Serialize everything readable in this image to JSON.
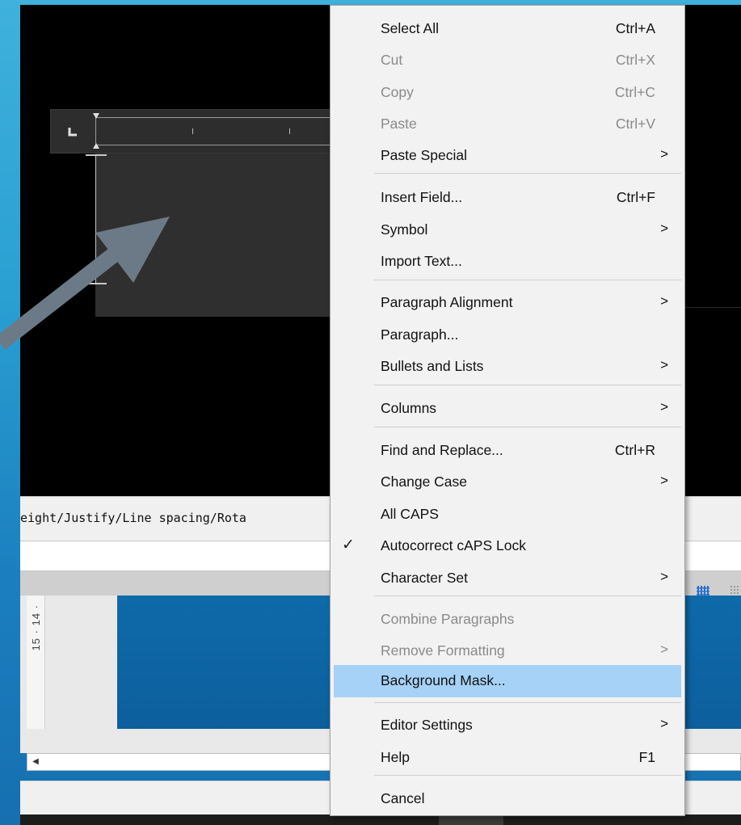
{
  "background": {
    "gradient_top": "#3fb1dc",
    "gradient_bottom": "#166fb0"
  },
  "editor": {
    "command_text": "eight/Justify/Line spacing/Rota",
    "vertical_ruler_text": "15 · 14 ·",
    "highlight_color": "#a7d2f7"
  },
  "menu": {
    "items": [
      {
        "label": "Select All",
        "shortcut": "Ctrl+A",
        "submenu": false,
        "disabled": false
      },
      {
        "label": "Cut",
        "shortcut": "Ctrl+X",
        "submenu": false,
        "disabled": true
      },
      {
        "label": "Copy",
        "shortcut": "Ctrl+C",
        "submenu": false,
        "disabled": true
      },
      {
        "label": "Paste",
        "shortcut": "Ctrl+V",
        "submenu": false,
        "disabled": true
      },
      {
        "label": "Paste Special",
        "shortcut": "",
        "submenu": true,
        "disabled": false
      },
      {
        "label": "Insert Field...",
        "shortcut": "Ctrl+F",
        "submenu": false,
        "disabled": false
      },
      {
        "label": "Symbol",
        "shortcut": "",
        "submenu": true,
        "disabled": false
      },
      {
        "label": "Import Text...",
        "shortcut": "",
        "submenu": false,
        "disabled": false
      },
      {
        "label": "Paragraph Alignment",
        "shortcut": "",
        "submenu": true,
        "disabled": false
      },
      {
        "label": "Paragraph...",
        "shortcut": "",
        "submenu": false,
        "disabled": false
      },
      {
        "label": "Bullets and Lists",
        "shortcut": "",
        "submenu": true,
        "disabled": false
      },
      {
        "label": "Columns",
        "shortcut": "",
        "submenu": true,
        "disabled": false
      },
      {
        "label": "Find and Replace...",
        "shortcut": "Ctrl+R",
        "submenu": false,
        "disabled": false
      },
      {
        "label": "Change Case",
        "shortcut": "",
        "submenu": true,
        "disabled": false
      },
      {
        "label": "All CAPS",
        "shortcut": "",
        "submenu": false,
        "disabled": false
      },
      {
        "label": "Autocorrect cAPS Lock",
        "shortcut": "",
        "submenu": false,
        "disabled": false,
        "checked": true
      },
      {
        "label": "Character Set",
        "shortcut": "",
        "submenu": true,
        "disabled": false
      },
      {
        "label": "Combine Paragraphs",
        "shortcut": "",
        "submenu": false,
        "disabled": true
      },
      {
        "label": "Remove Formatting",
        "shortcut": "",
        "submenu": true,
        "disabled": true
      },
      {
        "label": "Background Mask...",
        "shortcut": "",
        "submenu": false,
        "disabled": false,
        "highlighted": true
      },
      {
        "label": "Editor Settings",
        "shortcut": "",
        "submenu": true,
        "disabled": false
      },
      {
        "label": "Help",
        "shortcut": "F1",
        "submenu": false,
        "disabled": false
      },
      {
        "label": "Cancel",
        "shortcut": "",
        "submenu": false,
        "disabled": false
      }
    ],
    "submenu_glyph": ">",
    "check_glyph": "✓"
  },
  "icons": {
    "tab_stop": "tab-stop-icon",
    "arrow": "arrow-pointer-icon",
    "grid": "grid-icon",
    "scroll_left": "scroll-left-arrow-icon"
  }
}
